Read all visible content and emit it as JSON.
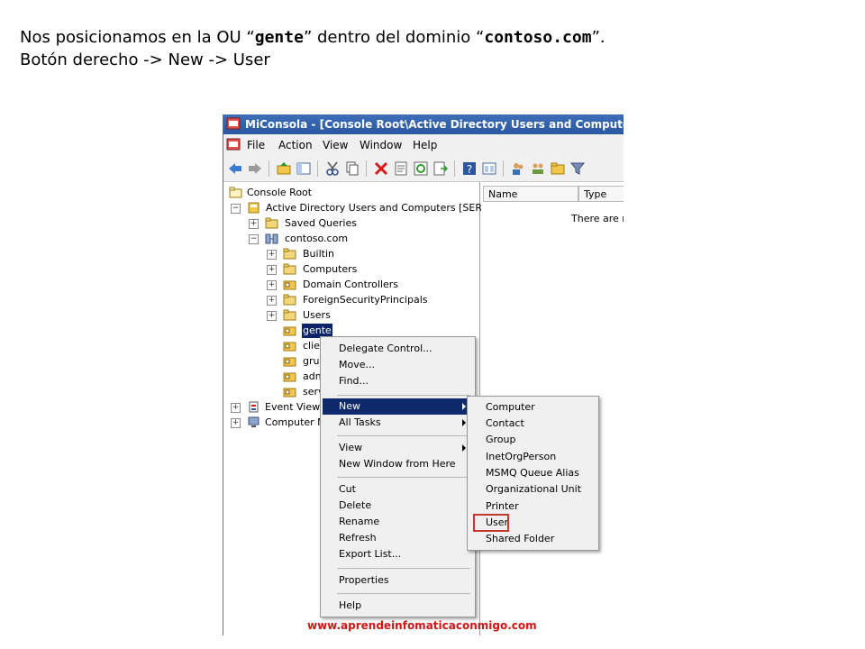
{
  "instructions": {
    "line1_pre": "Nos posicionamos en la OU “",
    "ou": "gente",
    "line1_mid": "”  dentro del dominio “",
    "domain": "contoso.com",
    "line1_post": "”.",
    "line2": "Botón derecho -> New -> User"
  },
  "window": {
    "title": "MiConsola - [Console Root\\Active Directory Users and Computers [SERV"
  },
  "menubar": [
    "File",
    "Action",
    "View",
    "Window",
    "Help"
  ],
  "toolbar_icons": [
    "back-icon",
    "forward-icon",
    "up-folder-icon",
    "show-hide-tree-icon",
    "cut-icon",
    "copy-icon",
    "delete-icon",
    "properties-icon",
    "refresh-icon",
    "export-icon",
    "help-icon",
    "console-icon",
    "users-icon",
    "groups-icon",
    "folder-icon",
    "filter-icon"
  ],
  "tree": {
    "console_root": "Console Root",
    "aduc": "Active Directory Users and Computers [SERV",
    "saved_queries": "Saved Queries",
    "domain": "contoso.com",
    "builtin": "Builtin",
    "computers": "Computers",
    "domain_controllers": "Domain Controllers",
    "fsp": "ForeignSecurityPrincipals",
    "users": "Users",
    "gente": "gente",
    "clientes": "clier",
    "grupos": "grup",
    "admin": "adm",
    "servers": "serv",
    "event_viewer": "Event Viewe",
    "computer_mgmt": "Computer M"
  },
  "list": {
    "columns": [
      "Name",
      "Type"
    ],
    "empty_message": "There are n"
  },
  "context_menu": {
    "delegate": "Delegate Control...",
    "move": "Move...",
    "find": "Find...",
    "new": "New",
    "all_tasks": "All Tasks",
    "view": "View",
    "new_window": "New Window from Here",
    "cut": "Cut",
    "delete": "Delete",
    "rename": "Rename",
    "refresh": "Refresh",
    "export": "Export List...",
    "properties": "Properties",
    "help": "Help"
  },
  "new_submenu": {
    "computer": "Computer",
    "contact": "Contact",
    "group": "Group",
    "inetorgperson": "InetOrgPerson",
    "msmq": "MSMQ Queue Alias",
    "ou": "Organizational Unit",
    "printer": "Printer",
    "user": "User",
    "shared_folder": "Shared Folder"
  },
  "watermark": "www.aprendeinfomaticaconmigo.com",
  "colors": {
    "selection": "#0a246a",
    "highlight_box": "#c0392b",
    "watermark": "#d11414"
  }
}
